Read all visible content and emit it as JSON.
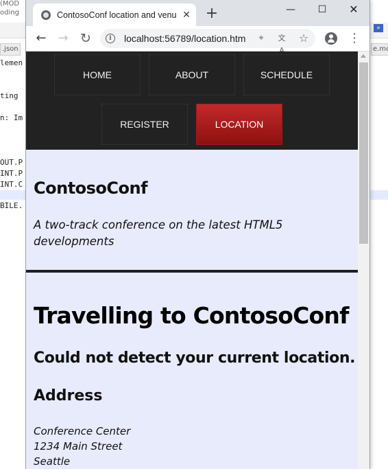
{
  "background_editor": {
    "top_text": "(MOD",
    "coding_text": "oding",
    "tab_left": ".json",
    "tab_right": "e.md",
    "code_lines": [
      "lemen",
      "ting",
      "n: Im",
      "OUT.P",
      "INT.P",
      "INT.C",
      "BILE."
    ]
  },
  "browser": {
    "tab_title": "ContosoConf location and venue",
    "tab_close": "✕",
    "new_tab": "+",
    "window_controls": {
      "minimize": "—",
      "maximize": "☐",
      "close": "✕"
    },
    "url": "localhost:56789/location.htm",
    "icons": [
      "back-icon",
      "forward-icon",
      "reload-icon",
      "info-icon",
      "location-blocked-icon",
      "translate-icon",
      "star-icon",
      "profile-icon",
      "menu-icon"
    ]
  },
  "site": {
    "nav": [
      {
        "label": "HOME",
        "active": false
      },
      {
        "label": "ABOUT",
        "active": false
      },
      {
        "label": "SCHEDULE",
        "active": false
      },
      {
        "label": "REGISTER",
        "active": false
      },
      {
        "label": "LOCATION",
        "active": true
      }
    ],
    "title": "ContosoConf",
    "tagline": "A two-track conference on the latest HTML5 developments"
  },
  "main": {
    "heading": "Travelling to ContosoConf",
    "status": "Could not detect your current location.",
    "address_heading": "Address",
    "address_lines": [
      "Conference Center",
      "1234 Main Street",
      "Seattle"
    ]
  },
  "colors": {
    "nav_bg": "#222222",
    "active_nav": "#a51818",
    "page_bg": "#e8ebfb"
  }
}
